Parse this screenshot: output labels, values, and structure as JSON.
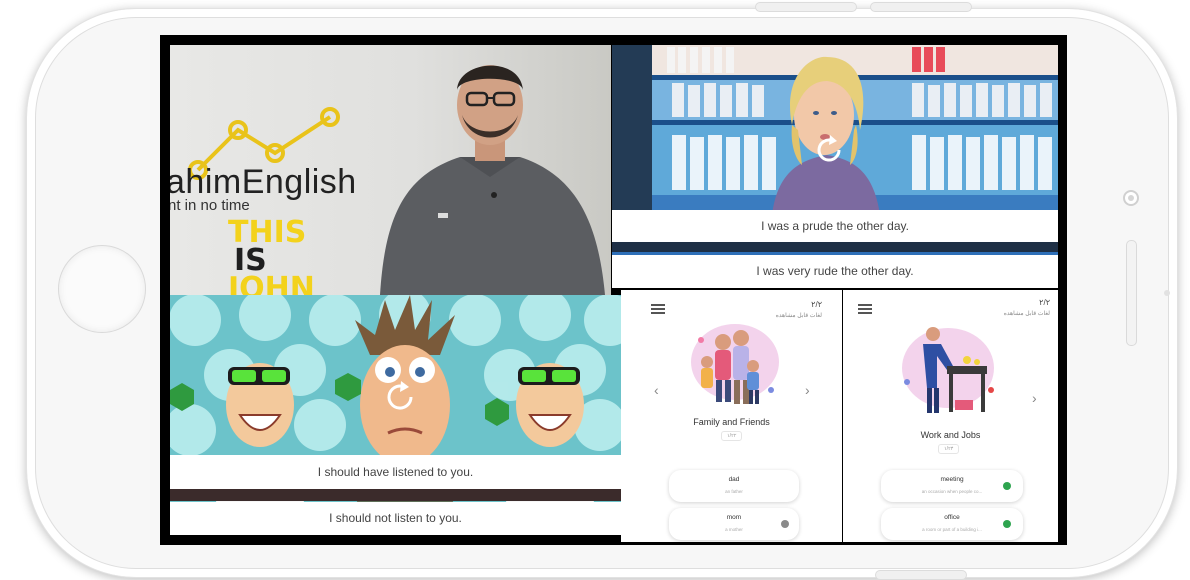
{
  "video_panels": {
    "presenter": {
      "brand": "ahimEnglish",
      "brand_sub": "nt in no time",
      "title_line1": "THIS",
      "title_line2": "IS",
      "title_line3": "JOHN"
    },
    "shop": {
      "caption_top": "I was a prude the other day.",
      "caption_bottom": "I was very rude the other day."
    },
    "cartoon": {
      "caption_top": "I should have listened to you.",
      "caption_bottom": "I should not listen to you."
    }
  },
  "app_screens": [
    {
      "pager": "۲/۲",
      "subtitle": "لغات قابل مشاهده",
      "category": "Family and Friends",
      "count": "۱/۲۲",
      "words": [
        {
          "word": "dad",
          "definition": "an father"
        },
        {
          "word": "mom",
          "definition": "a mother"
        }
      ]
    },
    {
      "pager": "۲/۲",
      "subtitle": "لغات قابل مشاهده",
      "category": "Work and Jobs",
      "count": "۱/۲۴",
      "words": [
        {
          "word": "meeting",
          "definition": "an occasion when people co..."
        },
        {
          "word": "office",
          "definition": "a room or part of a building i..."
        }
      ]
    }
  ],
  "colors": {
    "accent_green": "#2ea44f",
    "title_yellow": "#f3d21c"
  }
}
